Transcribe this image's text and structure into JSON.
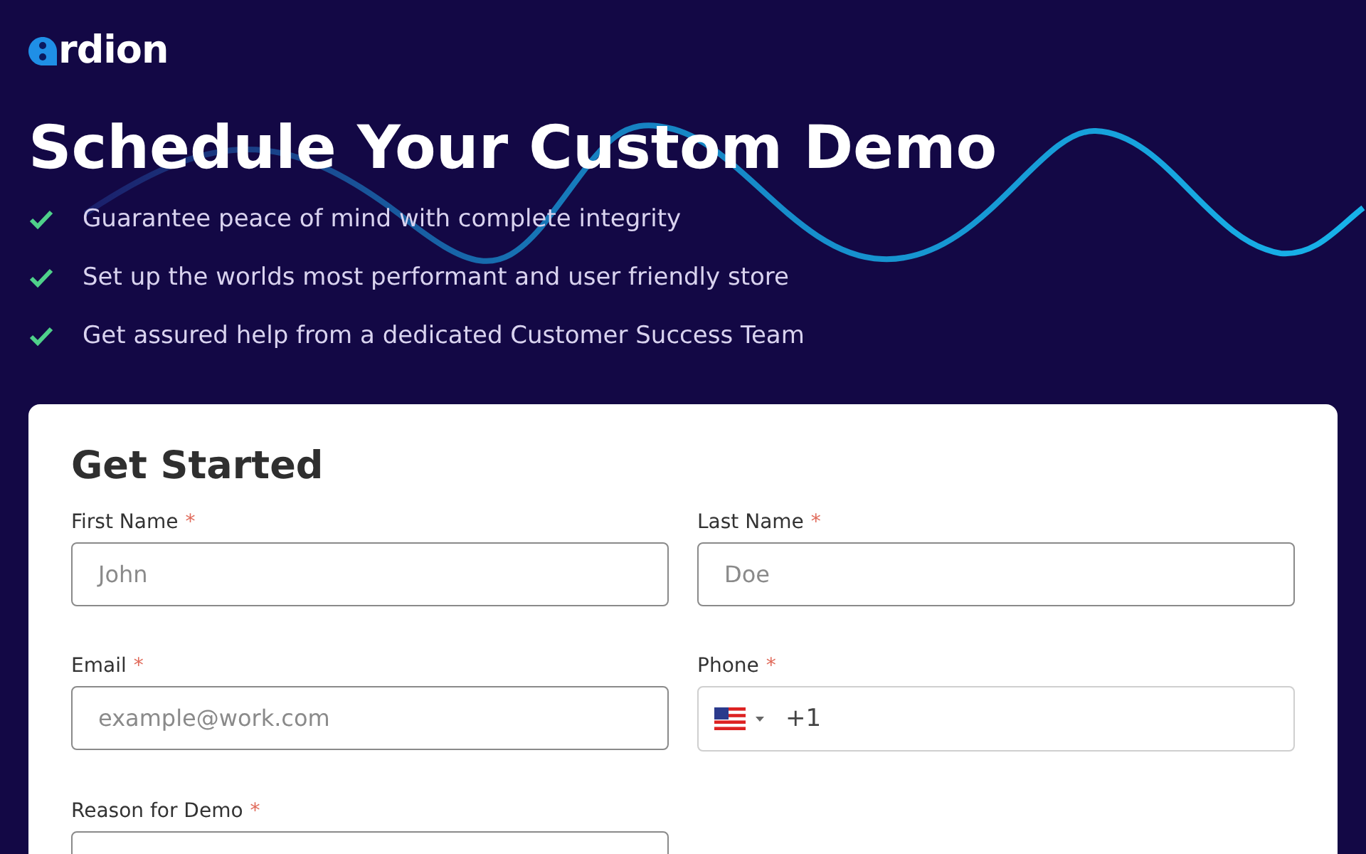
{
  "logo": {
    "text": "rdion"
  },
  "title": "Schedule Your Custom Demo",
  "benefits": [
    "Guarantee peace of mind with complete integrity",
    "Set up the worlds most performant and user friendly store",
    "Get assured help from a dedicated Customer Success Team"
  ],
  "form": {
    "title": "Get Started",
    "fields": [
      {
        "kind": "text",
        "label": "First Name",
        "required_mark": "*",
        "placeholder": "John"
      },
      {
        "kind": "text",
        "label": "Last Name",
        "required_mark": "*",
        "placeholder": "Doe"
      },
      {
        "kind": "text",
        "label": "Email",
        "required_mark": "*",
        "placeholder": "example@work.com"
      },
      {
        "kind": "phone",
        "label": "Phone",
        "required_mark": "*",
        "value": "+1"
      },
      {
        "kind": "select",
        "label": "Reason for Demo",
        "required_mark": "*"
      }
    ]
  }
}
